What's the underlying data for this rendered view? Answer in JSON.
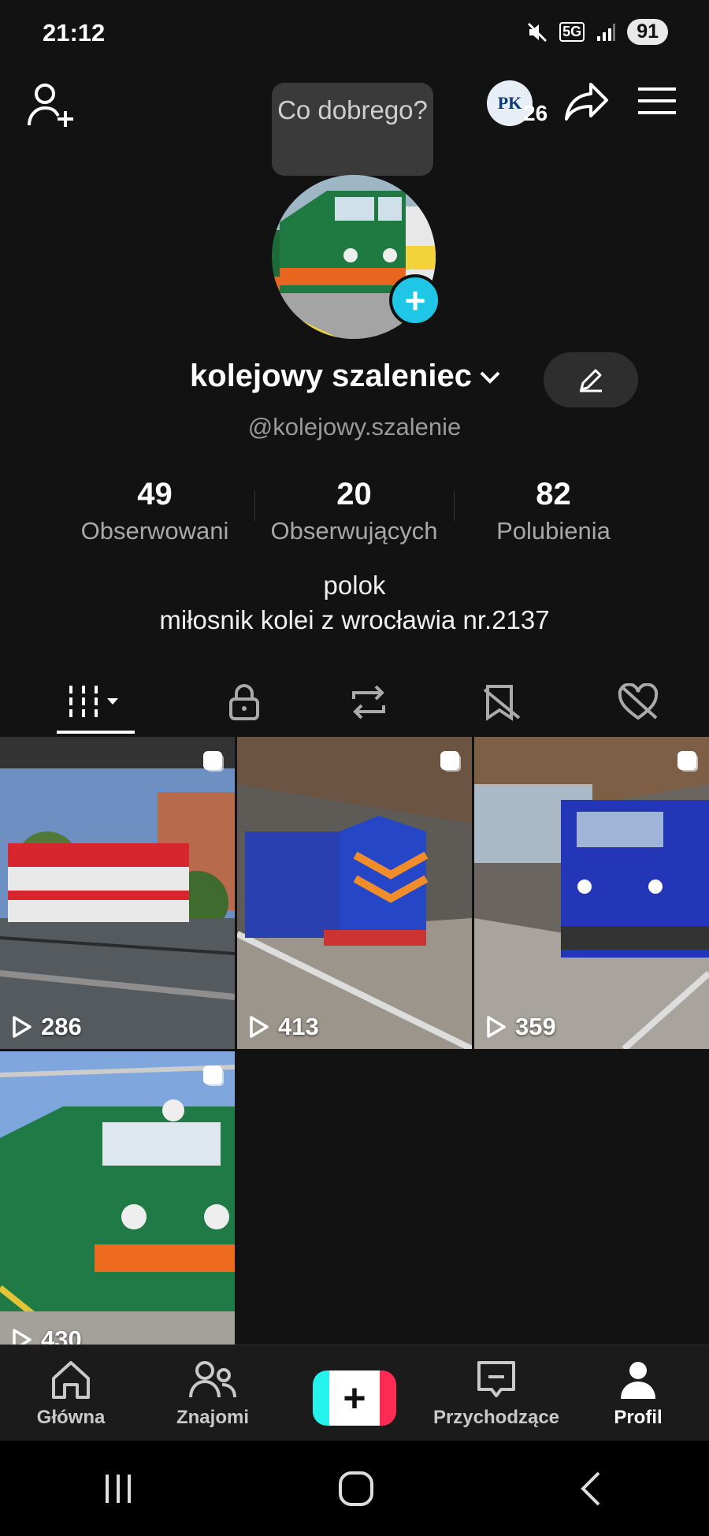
{
  "status_bar": {
    "time": "21:12",
    "battery": "91",
    "network": "5G"
  },
  "header": {
    "add_friend_icon": "person-plus-icon",
    "tooltip_text": "Co dobrego?",
    "badge_initials": "PK",
    "badge_count": "26",
    "share_icon": "share-arrow-icon",
    "menu_icon": "hamburger-icon"
  },
  "profile": {
    "display_name": "kolejowy szaleniec",
    "handle": "@kolejowy.szalenie",
    "stats": [
      {
        "value": "49",
        "label": "Obserwowani"
      },
      {
        "value": "20",
        "label": "Obserwujących"
      },
      {
        "value": "82",
        "label": "Polubienia"
      }
    ],
    "bio_line1": "polok",
    "bio_line2": "miłosnik kolei z wrocławia nr.2137"
  },
  "tabs": [
    {
      "icon": "grid-videos-icon",
      "active": true
    },
    {
      "icon": "lock-icon"
    },
    {
      "icon": "repost-icon"
    },
    {
      "icon": "bookmark-icon"
    },
    {
      "icon": "liked-heart-icon"
    }
  ],
  "videos": [
    {
      "views": "286",
      "label": "red-white locomotive"
    },
    {
      "views": "413",
      "label": "blue locomotive in station"
    },
    {
      "views": "359",
      "label": "blue intercity locomotive"
    },
    {
      "views": "430",
      "label": "green SU45 locomotive"
    }
  ],
  "bottom_nav": [
    {
      "label": "Główna",
      "icon": "home-icon"
    },
    {
      "label": "Znajomi",
      "icon": "friends-icon"
    },
    {
      "label": "",
      "icon": "create-plus-icon"
    },
    {
      "label": "Przychodzące",
      "icon": "inbox-icon"
    },
    {
      "label": "Profil",
      "icon": "profile-icon"
    }
  ],
  "colors": {
    "accent": "#20c6e6",
    "background": "#121212"
  }
}
